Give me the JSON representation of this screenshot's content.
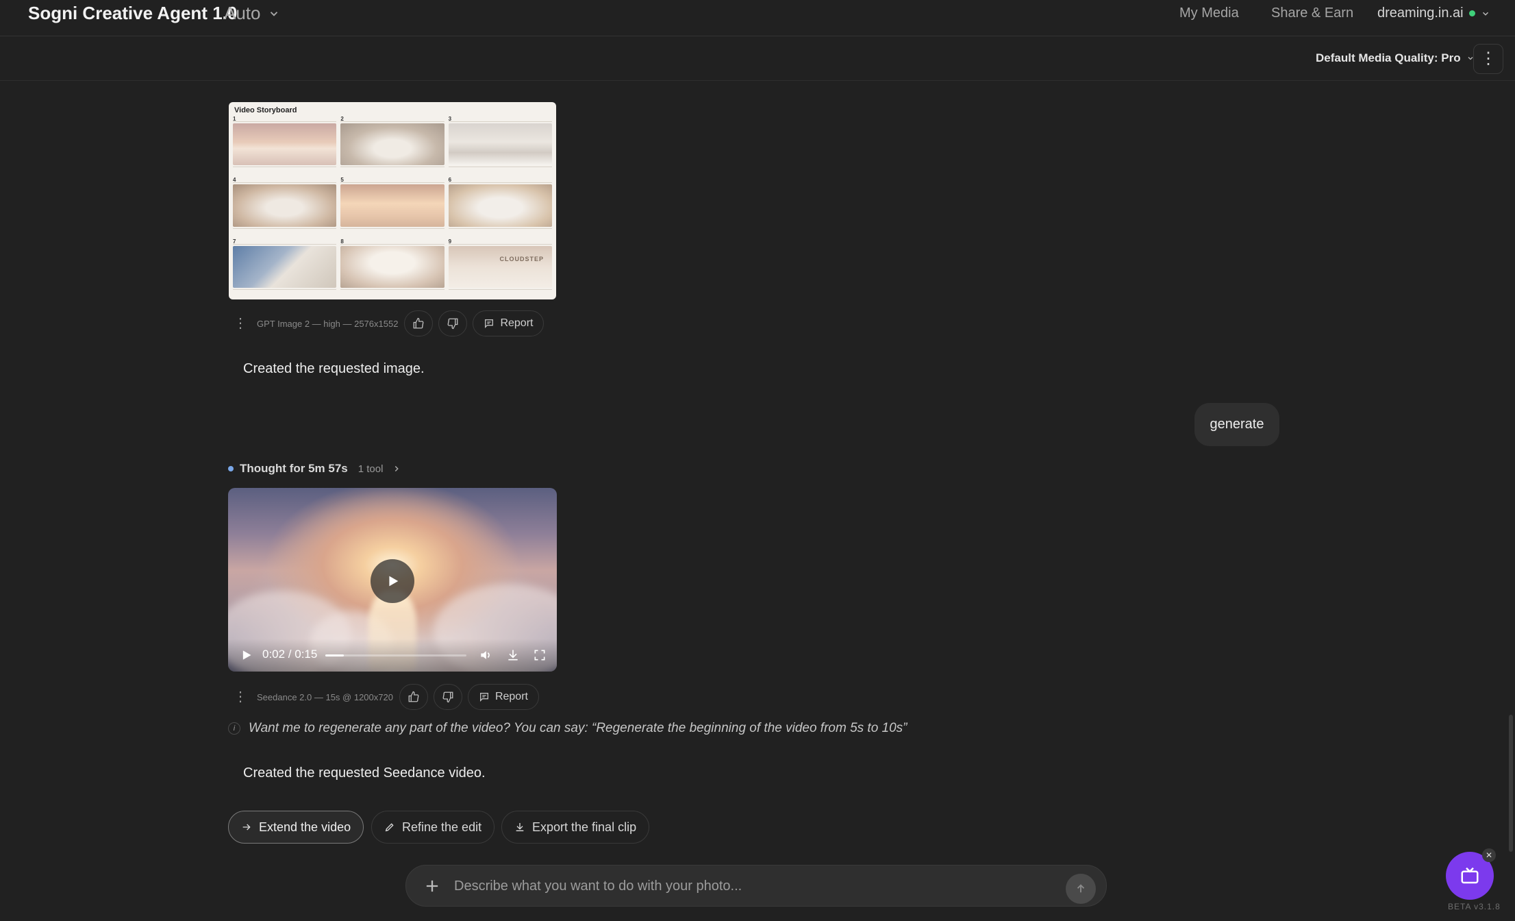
{
  "header": {
    "brand": "Sogni Creative Agent 1.0",
    "model_mode": "Auto",
    "nav": [
      "My Media",
      "Share & Earn"
    ],
    "user": "dreaming.in.ai",
    "user_status_color": "#3fd07a"
  },
  "subbar": {
    "quality_label": "Default Media Quality: Pro"
  },
  "messages": {
    "storyboard": {
      "title": "Video Storyboard",
      "logo_text": "CLOUDSTEP",
      "scene_numbers": [
        "1",
        "2",
        "3",
        "4",
        "5",
        "6",
        "7",
        "8",
        "9"
      ],
      "meta": "GPT Image 2 — high — 2576x1552",
      "report_label": "Report",
      "caption": "Created the requested image."
    },
    "user_prompt": "generate",
    "thought": {
      "label": "Thought for 5m 57s",
      "tools": "1 tool"
    },
    "video": {
      "time": "0:02 / 0:15",
      "progress": 0.13,
      "meta": "Seedance 2.0 — 15s @ 1200x720",
      "report_label": "Report",
      "hint": "Want me to regenerate any part of the video? You can say: “Regenerate the beginning of the video from 5s to 10s”",
      "caption": "Created the requested Seedance video."
    },
    "suggestions": [
      "Extend the video",
      "Refine the edit",
      "Export the final clip"
    ]
  },
  "composer": {
    "placeholder": "Describe what you want to do with your photo..."
  },
  "footer": {
    "version": "BETA v3.1.8",
    "fab_color": "#7c3aed"
  }
}
